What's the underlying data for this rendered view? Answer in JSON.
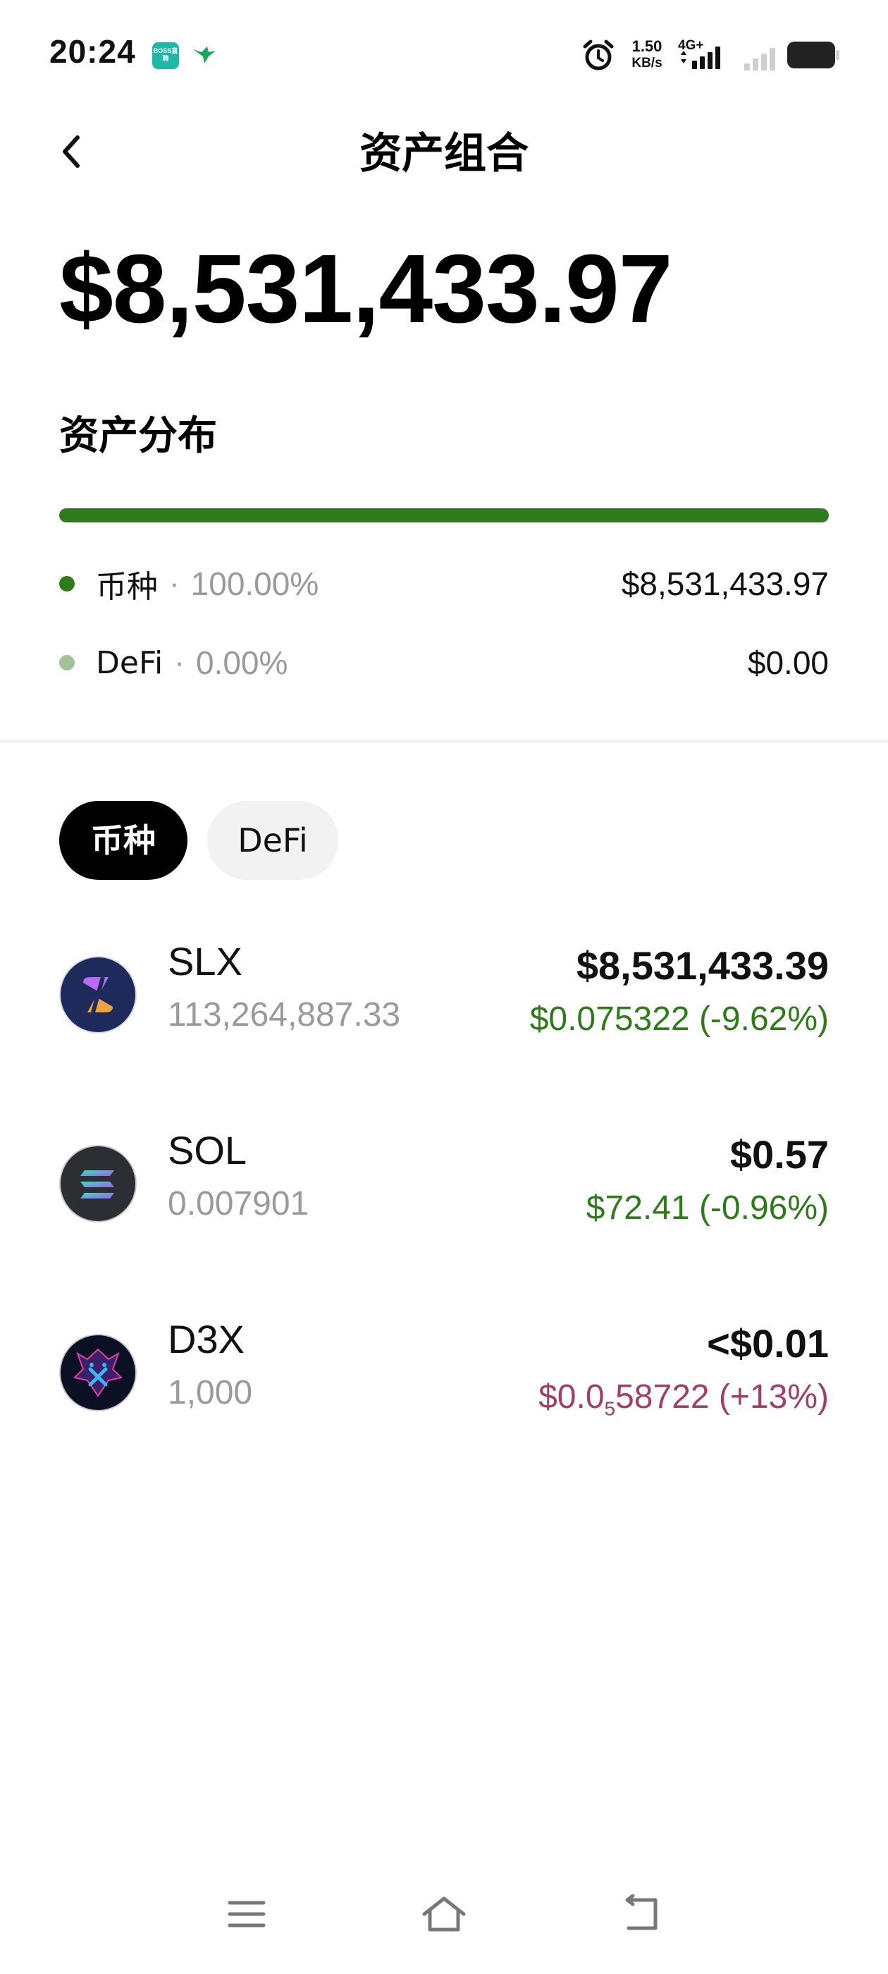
{
  "status_bar": {
    "time": "20:24",
    "app_badge": "BOSS直聘",
    "net_speed_value": "1.50",
    "net_speed_unit": "KB/s",
    "network_type": "4G+"
  },
  "header": {
    "title": "资产组合",
    "back_icon": "chevron-left-icon"
  },
  "portfolio": {
    "total_value": "$8,531,433.97"
  },
  "distribution": {
    "title": "资产分布",
    "coin_fraction": 1.0,
    "items": [
      {
        "label": "币种",
        "percent": "100.00%",
        "value": "$8,531,433.97",
        "color": "#2f7a1b"
      },
      {
        "label": "DeFi",
        "percent": "0.00%",
        "value": "$0.00",
        "color": "#a5c196"
      }
    ]
  },
  "tabs": [
    {
      "label": "币种",
      "active": true
    },
    {
      "label": "DeFi",
      "active": false
    }
  ],
  "assets": [
    {
      "symbol": "SLX",
      "amount": "113,264,887.33",
      "value": "$8,531,433.39",
      "price": "$0.075322 (-9.62%)",
      "price_color": "#2f7a1b",
      "icon": "slx-token-icon"
    },
    {
      "symbol": "SOL",
      "amount": "0.007901",
      "value": "$0.57",
      "price": "$72.41 (-0.96%)",
      "price_color": "#2f7a1b",
      "icon": "solana-token-icon"
    },
    {
      "symbol": "D3X",
      "amount": "1,000",
      "value": "<$0.01",
      "price_prefix": "$0.0",
      "price_subscript": "5",
      "price_suffix": "58722 (+13%)",
      "price_color": "#a0406a",
      "icon": "d3x-token-icon"
    }
  ],
  "colors": {
    "gain_down": "#2f7a1b",
    "gain_up": "#a0406a",
    "tab_active_bg": "#000000",
    "tab_inactive_bg": "#f2f2f2"
  }
}
